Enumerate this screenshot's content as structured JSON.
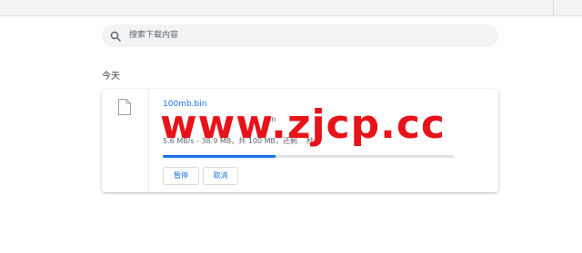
{
  "search": {
    "placeholder": "搜索下载内容"
  },
  "section": {
    "title": "今天"
  },
  "download": {
    "file_name": "100mb.bin",
    "url_fragment": "bin",
    "status": "5.6 MB/s - 38.9 MB，共 100 MB，还剩",
    "status_tail": "秒",
    "progress_fraction": 0.389,
    "pause_label": "暂停",
    "cancel_label": "取消"
  },
  "watermark": {
    "text": "www.zjcp.cc"
  },
  "colors": {
    "accent": "#1a73e8",
    "watermark": "#e8121a"
  },
  "icons": {
    "search": "search-icon",
    "file": "file-icon"
  }
}
